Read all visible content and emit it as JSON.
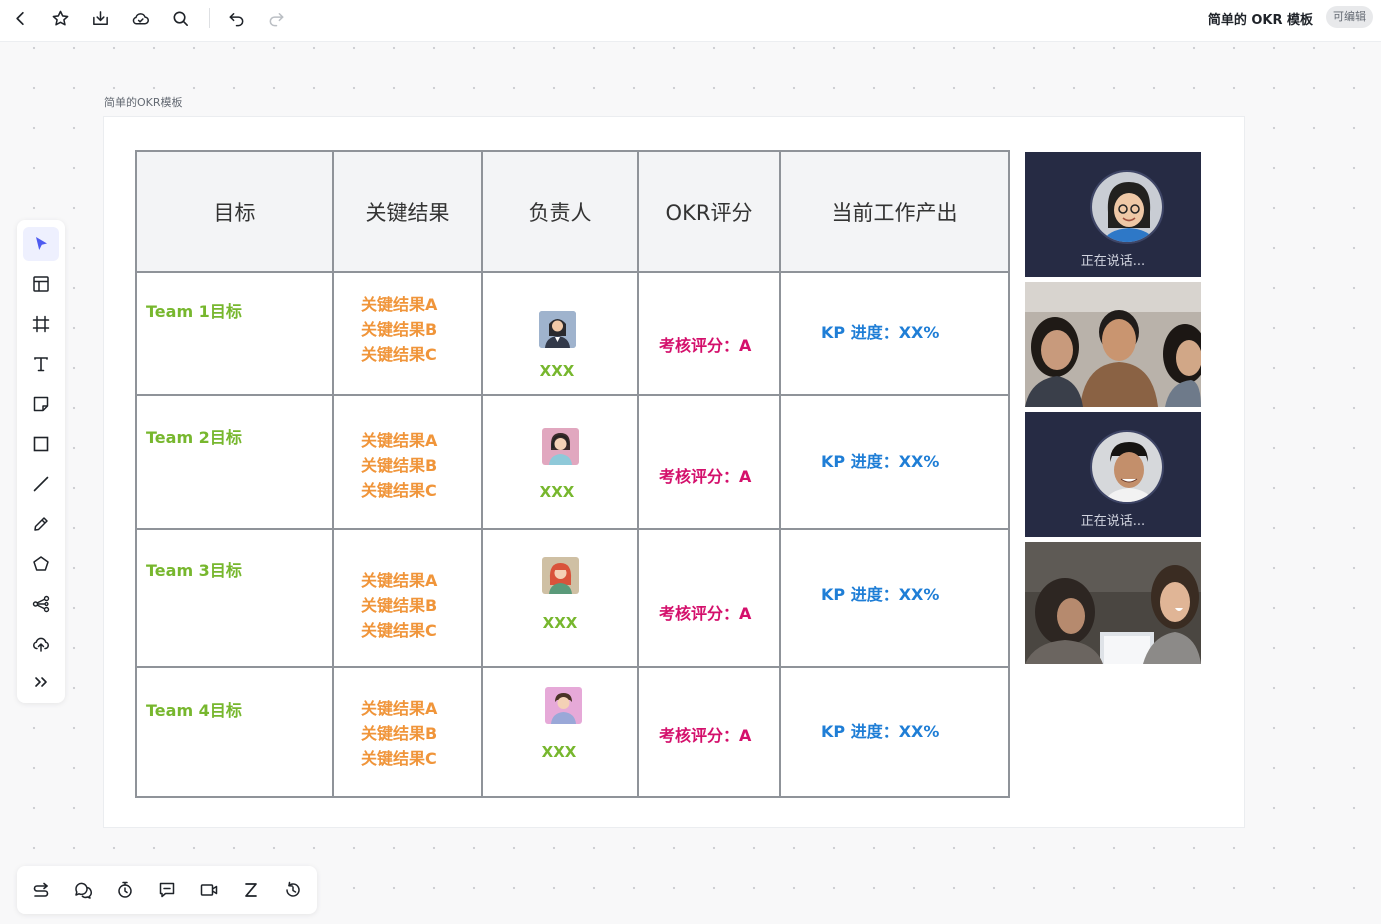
{
  "app": {
    "doc_title": "简单的 OKR 模板",
    "permission_badge": "可编辑",
    "frame_label": "简单的OKR模板"
  },
  "table": {
    "headers": [
      "目标",
      "关键结果",
      "负责人",
      "OKR评分",
      "当前工作产出"
    ],
    "rows": [
      {
        "goal": "Team 1目标",
        "krs": [
          "关键结果A",
          "关键结果B",
          "关键结果C"
        ],
        "owner": "XXX",
        "score": "考核评分：A",
        "progress": "KP 进度：XX%"
      },
      {
        "goal": "Team 2目标",
        "krs": [
          "关键结果A",
          "关键结果B",
          "关键结果C"
        ],
        "owner": "XXX",
        "score": "考核评分：A",
        "progress": "KP 进度：XX%"
      },
      {
        "goal": "Team 3目标",
        "krs": [
          "关键结果A",
          "关键结果B",
          "关键结果C"
        ],
        "owner": "XXX",
        "score": "考核评分：A",
        "progress": "KP 进度：XX%"
      },
      {
        "goal": "Team 4目标",
        "krs": [
          "关键结果A",
          "关键结果B",
          "关键结果C"
        ],
        "owner": "XXX",
        "score": "考核评分：A",
        "progress": "KP 进度：XX%"
      }
    ]
  },
  "video_panels": [
    {
      "type": "speaking",
      "status": "正在说话..."
    },
    {
      "type": "photo"
    },
    {
      "type": "speaking",
      "status": "正在说话..."
    },
    {
      "type": "photo"
    }
  ],
  "colors": {
    "goal": "#77b72e",
    "key_result": "#f0953a",
    "score": "#d4106c",
    "progress": "#1f7ed6",
    "accent": "#4e5bf0"
  },
  "icons": {
    "top_toolbar": [
      "back-icon",
      "star-icon",
      "download-icon",
      "cloud-icon",
      "search-icon",
      "undo-icon",
      "redo-icon"
    ],
    "left_toolbar": [
      "select-cursor-icon",
      "template-icon",
      "frame-icon",
      "text-icon",
      "sticky-note-icon",
      "rectangle-icon",
      "line-icon",
      "pen-icon",
      "polygon-icon",
      "mindmap-icon",
      "upload-icon",
      "more-icon"
    ],
    "bottom_toolbar": [
      "switch-icon",
      "comment-icon",
      "timer-icon",
      "chat-icon",
      "video-icon",
      "sleep-icon",
      "history-icon"
    ]
  }
}
